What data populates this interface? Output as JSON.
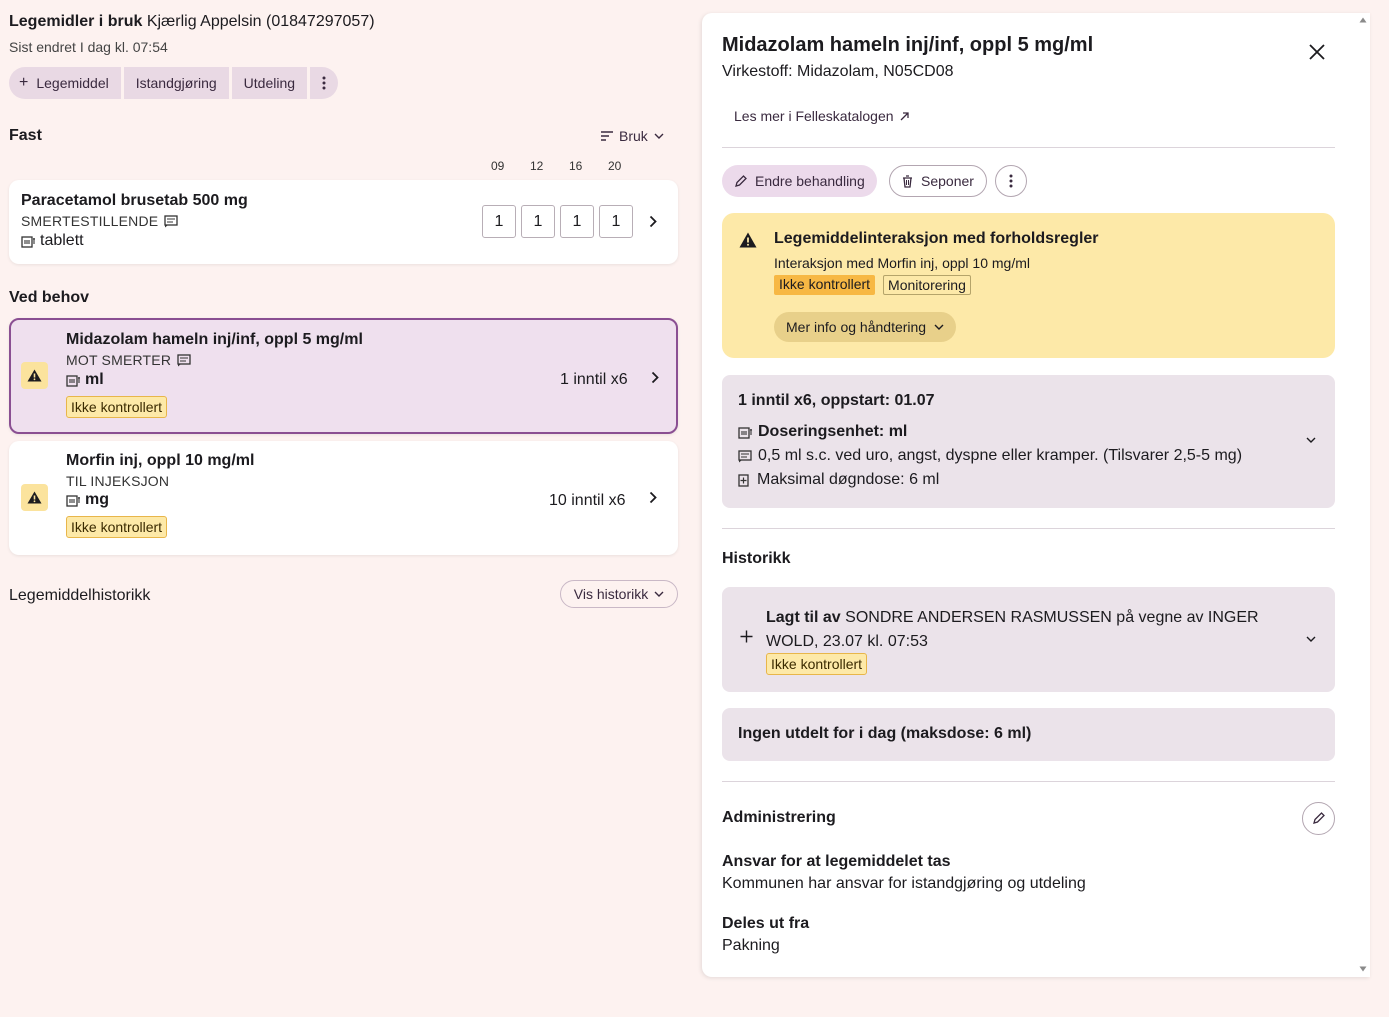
{
  "header": {
    "title_bold": "Legemidler i bruk",
    "patient": "Kjærlig Appelsin (01847297057)",
    "subtitle": "Sist endret I dag kl. 07:54"
  },
  "actions": {
    "add_label": "Legemiddel",
    "prepare_label": "Istandgjøring",
    "dispense_label": "Utdeling"
  },
  "fast": {
    "label": "Fast",
    "sort_label": "Bruk",
    "times": [
      "09",
      "12",
      "16",
      "20"
    ],
    "item": {
      "name": "Paracetamol brusetab 500 mg",
      "category": "SMERTESTILLENDE",
      "unit": "tablett",
      "doses": [
        "1",
        "1",
        "1",
        "1"
      ]
    }
  },
  "ved_behov": {
    "label": "Ved behov",
    "items": [
      {
        "name": "Midazolam hameln inj/inf, oppl 5 mg/ml",
        "category": "MOT SMERTER",
        "unit": "ml",
        "dosage": "1 inntil x6",
        "tag": "Ikke kontrollert"
      },
      {
        "name": "Morfin inj, oppl 10 mg/ml",
        "category": "TIL INJEKSJON",
        "unit": "mg",
        "dosage": "10 inntil x6",
        "tag": "Ikke kontrollert"
      }
    ]
  },
  "history": {
    "label": "Legemiddelhistorikk",
    "button": "Vis historikk"
  },
  "panel": {
    "title": "Midazolam hameln inj/inf, oppl 5 mg/ml",
    "substance": "Virkestoff: Midazolam, N05CD08",
    "link": "Les mer i Felleskatalogen",
    "change_btn": "Endre behandling",
    "stop_btn": "Seponer",
    "alert": {
      "title": "Legemiddelinteraksjon med forholdsregler",
      "subtitle": "Interaksjon med Morfin inj, oppl 10 mg/ml",
      "tag1": "Ikke kontrollert",
      "tag2": "Monitorering",
      "button": "Mer info og håndtering"
    },
    "dosing": {
      "title": "1 inntil x6, oppstart: 01.07",
      "unit_label": "Doseringsenhet: ml",
      "instruction": "0,5 ml s.c. ved uro, angst, dyspne eller kramper. (Tilsvarer 2,5-5 mg)",
      "max": "Maksimal døgndose: 6 ml"
    },
    "historikk": {
      "heading": "Historikk",
      "entry_bold": "Lagt til av",
      "entry_line1": "SONDRE ANDERSEN RASMUSSEN på vegne av INGER",
      "entry_line2": "WOLD, 23.07 kl. 07:53",
      "tag": "Ikke kontrollert"
    },
    "today": "Ingen utdelt for i dag (maksdose: 6 ml)",
    "admin": {
      "heading": "Administrering",
      "resp_label": "Ansvar for at legemiddelet tas",
      "resp_value": "Kommunen har ansvar for istandgjøring og utdeling",
      "from_label": "Deles ut fra",
      "from_value": "Pakning"
    }
  }
}
